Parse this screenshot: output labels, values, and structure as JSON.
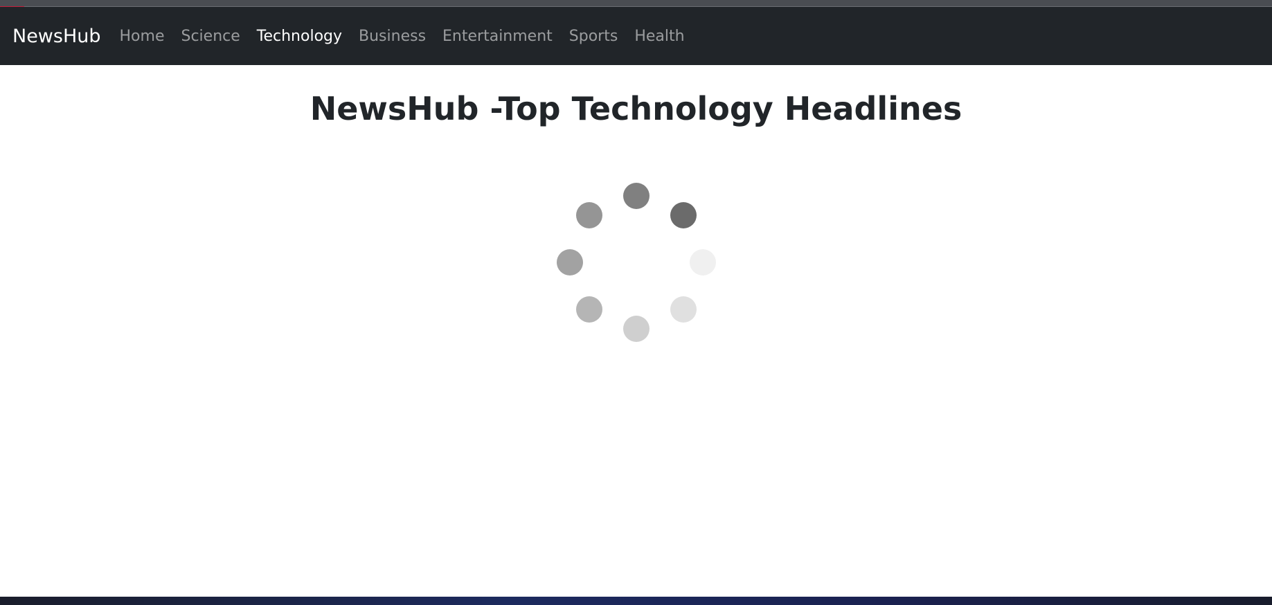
{
  "navbar": {
    "brand": "NewsHub",
    "links": [
      {
        "label": "Home",
        "active": false
      },
      {
        "label": "Science",
        "active": false
      },
      {
        "label": "Technology",
        "active": true
      },
      {
        "label": "Business",
        "active": false
      },
      {
        "label": "Entertainment",
        "active": false
      },
      {
        "label": "Sports",
        "active": false
      },
      {
        "label": "Health",
        "active": false
      }
    ]
  },
  "main": {
    "heading": "NewsHub -Top Technology Headlines"
  },
  "loader": {
    "icon": "loading-spinner-icon",
    "dot_colors": [
      "#808080",
      "#6b6b6b",
      "#f0f0f0",
      "#e0e0e0",
      "#cfcfcf",
      "#b5b5b5",
      "#a2a2a2",
      "#959595"
    ]
  },
  "colors": {
    "navbar_bg": "#212529",
    "progress_accent": "#c81e3c",
    "text_dark": "#212529"
  }
}
